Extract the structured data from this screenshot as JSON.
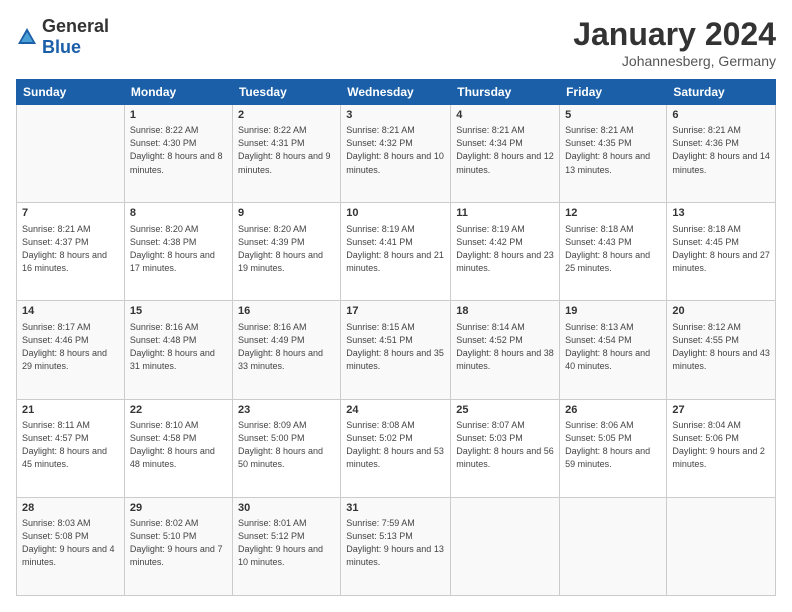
{
  "header": {
    "logo_general": "General",
    "logo_blue": "Blue",
    "month_year": "January 2024",
    "location": "Johannesberg, Germany"
  },
  "weekdays": [
    "Sunday",
    "Monday",
    "Tuesday",
    "Wednesday",
    "Thursday",
    "Friday",
    "Saturday"
  ],
  "weeks": [
    [
      {
        "day": "",
        "sunrise": "",
        "sunset": "",
        "daylight": ""
      },
      {
        "day": "1",
        "sunrise": "Sunrise: 8:22 AM",
        "sunset": "Sunset: 4:30 PM",
        "daylight": "Daylight: 8 hours and 8 minutes."
      },
      {
        "day": "2",
        "sunrise": "Sunrise: 8:22 AM",
        "sunset": "Sunset: 4:31 PM",
        "daylight": "Daylight: 8 hours and 9 minutes."
      },
      {
        "day": "3",
        "sunrise": "Sunrise: 8:21 AM",
        "sunset": "Sunset: 4:32 PM",
        "daylight": "Daylight: 8 hours and 10 minutes."
      },
      {
        "day": "4",
        "sunrise": "Sunrise: 8:21 AM",
        "sunset": "Sunset: 4:34 PM",
        "daylight": "Daylight: 8 hours and 12 minutes."
      },
      {
        "day": "5",
        "sunrise": "Sunrise: 8:21 AM",
        "sunset": "Sunset: 4:35 PM",
        "daylight": "Daylight: 8 hours and 13 minutes."
      },
      {
        "day": "6",
        "sunrise": "Sunrise: 8:21 AM",
        "sunset": "Sunset: 4:36 PM",
        "daylight": "Daylight: 8 hours and 14 minutes."
      }
    ],
    [
      {
        "day": "7",
        "sunrise": "Sunrise: 8:21 AM",
        "sunset": "Sunset: 4:37 PM",
        "daylight": "Daylight: 8 hours and 16 minutes."
      },
      {
        "day": "8",
        "sunrise": "Sunrise: 8:20 AM",
        "sunset": "Sunset: 4:38 PM",
        "daylight": "Daylight: 8 hours and 17 minutes."
      },
      {
        "day": "9",
        "sunrise": "Sunrise: 8:20 AM",
        "sunset": "Sunset: 4:39 PM",
        "daylight": "Daylight: 8 hours and 19 minutes."
      },
      {
        "day": "10",
        "sunrise": "Sunrise: 8:19 AM",
        "sunset": "Sunset: 4:41 PM",
        "daylight": "Daylight: 8 hours and 21 minutes."
      },
      {
        "day": "11",
        "sunrise": "Sunrise: 8:19 AM",
        "sunset": "Sunset: 4:42 PM",
        "daylight": "Daylight: 8 hours and 23 minutes."
      },
      {
        "day": "12",
        "sunrise": "Sunrise: 8:18 AM",
        "sunset": "Sunset: 4:43 PM",
        "daylight": "Daylight: 8 hours and 25 minutes."
      },
      {
        "day": "13",
        "sunrise": "Sunrise: 8:18 AM",
        "sunset": "Sunset: 4:45 PM",
        "daylight": "Daylight: 8 hours and 27 minutes."
      }
    ],
    [
      {
        "day": "14",
        "sunrise": "Sunrise: 8:17 AM",
        "sunset": "Sunset: 4:46 PM",
        "daylight": "Daylight: 8 hours and 29 minutes."
      },
      {
        "day": "15",
        "sunrise": "Sunrise: 8:16 AM",
        "sunset": "Sunset: 4:48 PM",
        "daylight": "Daylight: 8 hours and 31 minutes."
      },
      {
        "day": "16",
        "sunrise": "Sunrise: 8:16 AM",
        "sunset": "Sunset: 4:49 PM",
        "daylight": "Daylight: 8 hours and 33 minutes."
      },
      {
        "day": "17",
        "sunrise": "Sunrise: 8:15 AM",
        "sunset": "Sunset: 4:51 PM",
        "daylight": "Daylight: 8 hours and 35 minutes."
      },
      {
        "day": "18",
        "sunrise": "Sunrise: 8:14 AM",
        "sunset": "Sunset: 4:52 PM",
        "daylight": "Daylight: 8 hours and 38 minutes."
      },
      {
        "day": "19",
        "sunrise": "Sunrise: 8:13 AM",
        "sunset": "Sunset: 4:54 PM",
        "daylight": "Daylight: 8 hours and 40 minutes."
      },
      {
        "day": "20",
        "sunrise": "Sunrise: 8:12 AM",
        "sunset": "Sunset: 4:55 PM",
        "daylight": "Daylight: 8 hours and 43 minutes."
      }
    ],
    [
      {
        "day": "21",
        "sunrise": "Sunrise: 8:11 AM",
        "sunset": "Sunset: 4:57 PM",
        "daylight": "Daylight: 8 hours and 45 minutes."
      },
      {
        "day": "22",
        "sunrise": "Sunrise: 8:10 AM",
        "sunset": "Sunset: 4:58 PM",
        "daylight": "Daylight: 8 hours and 48 minutes."
      },
      {
        "day": "23",
        "sunrise": "Sunrise: 8:09 AM",
        "sunset": "Sunset: 5:00 PM",
        "daylight": "Daylight: 8 hours and 50 minutes."
      },
      {
        "day": "24",
        "sunrise": "Sunrise: 8:08 AM",
        "sunset": "Sunset: 5:02 PM",
        "daylight": "Daylight: 8 hours and 53 minutes."
      },
      {
        "day": "25",
        "sunrise": "Sunrise: 8:07 AM",
        "sunset": "Sunset: 5:03 PM",
        "daylight": "Daylight: 8 hours and 56 minutes."
      },
      {
        "day": "26",
        "sunrise": "Sunrise: 8:06 AM",
        "sunset": "Sunset: 5:05 PM",
        "daylight": "Daylight: 8 hours and 59 minutes."
      },
      {
        "day": "27",
        "sunrise": "Sunrise: 8:04 AM",
        "sunset": "Sunset: 5:06 PM",
        "daylight": "Daylight: 9 hours and 2 minutes."
      }
    ],
    [
      {
        "day": "28",
        "sunrise": "Sunrise: 8:03 AM",
        "sunset": "Sunset: 5:08 PM",
        "daylight": "Daylight: 9 hours and 4 minutes."
      },
      {
        "day": "29",
        "sunrise": "Sunrise: 8:02 AM",
        "sunset": "Sunset: 5:10 PM",
        "daylight": "Daylight: 9 hours and 7 minutes."
      },
      {
        "day": "30",
        "sunrise": "Sunrise: 8:01 AM",
        "sunset": "Sunset: 5:12 PM",
        "daylight": "Daylight: 9 hours and 10 minutes."
      },
      {
        "day": "31",
        "sunrise": "Sunrise: 7:59 AM",
        "sunset": "Sunset: 5:13 PM",
        "daylight": "Daylight: 9 hours and 13 minutes."
      },
      {
        "day": "",
        "sunrise": "",
        "sunset": "",
        "daylight": ""
      },
      {
        "day": "",
        "sunrise": "",
        "sunset": "",
        "daylight": ""
      },
      {
        "day": "",
        "sunrise": "",
        "sunset": "",
        "daylight": ""
      }
    ]
  ]
}
